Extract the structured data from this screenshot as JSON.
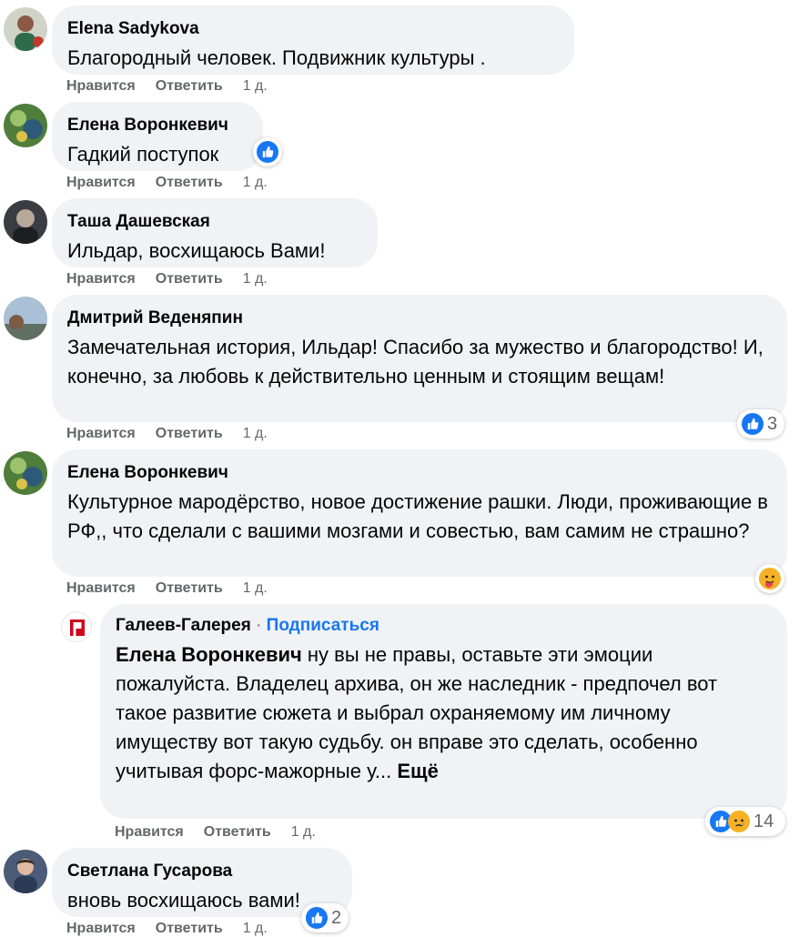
{
  "actions": {
    "like": "Нравится",
    "reply": "Ответить",
    "time": "1 д."
  },
  "comments": [
    {
      "author": "Elena Sadykova",
      "text": "Благородный человек. Подвижник культуры ."
    },
    {
      "author": "Елена Воронкевич",
      "text": "Гадкий поступок"
    },
    {
      "author": "Таша Дашевская",
      "text": "Ильдар, восхищаюсь Вами!"
    },
    {
      "author": "Дмитрий Веденяпин",
      "text": "Замечательная история, Ильдар! Спасибо за мужество и благородство! И, конечно, за любовь к действительно ценным и стоящим вещам!",
      "reaction_count": "3"
    },
    {
      "author": "Елена Воронкевич",
      "text": "Культурное мародёрство, новое достижение рашки. Люди, проживающие в РФ,, что сделали с вашими мозгами и совестью, вам самим не страшно?"
    },
    {
      "author": "Светлана Гусарова",
      "text": "вновь восхищаюсь вами!",
      "reaction_count": "2"
    }
  ],
  "reply": {
    "author": "Галеев-Галерея",
    "separator": "·",
    "follow": "Подписаться",
    "mention": "Елена Воронкевич",
    "text": " ну вы не правы, оставьте эти эмоции пожалуйста. Владелец архива, он же наследник - предпочел вот такое развитие сюжета и выбрал охраняемому им личному имуществу вот такую судьбу. он вправе это сделать, особенно учитывая форс-мажорные у...",
    "more": "Ещё",
    "reaction_count": "14"
  },
  "colors": {
    "bubble": "#f0f2f5",
    "like": "#1877f2",
    "meta": "#65676b",
    "link": "#1877f2"
  },
  "icons": [
    "like-icon",
    "care-icon",
    "sad-icon"
  ]
}
